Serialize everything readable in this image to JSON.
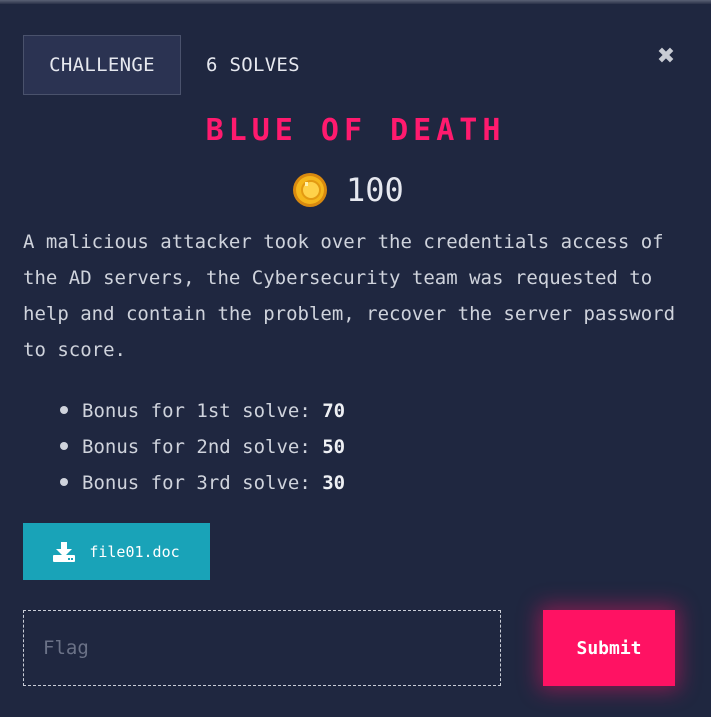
{
  "tabs": {
    "challenge_label": "CHALLENGE",
    "solves_label": "6 SOLVES"
  },
  "challenge": {
    "title": "BLUE OF DEATH",
    "points": "100",
    "description": "A malicious attacker took over the credentials access of the AD servers, the Cybersecurity team was requested to help and contain the problem, recover the server password to score.",
    "bonuses": [
      {
        "label": "Bonus for 1st solve:",
        "value": "70"
      },
      {
        "label": "Bonus for 2nd solve:",
        "value": "50"
      },
      {
        "label": "Bonus for 3rd solve:",
        "value": "30"
      }
    ],
    "file": {
      "name": "file01.doc",
      "icon": "download-icon"
    }
  },
  "form": {
    "flag_placeholder": "Flag",
    "flag_value": "",
    "submit_label": "Submit"
  },
  "icons": {
    "close": "close-icon",
    "coin": "coin-icon"
  },
  "colors": {
    "background": "#1f2740",
    "accent": "#ff1263",
    "title": "#ff1a6e",
    "file_button": "#19a3b8",
    "tab_active": "#2b3352",
    "coin": "#f5b71c"
  }
}
